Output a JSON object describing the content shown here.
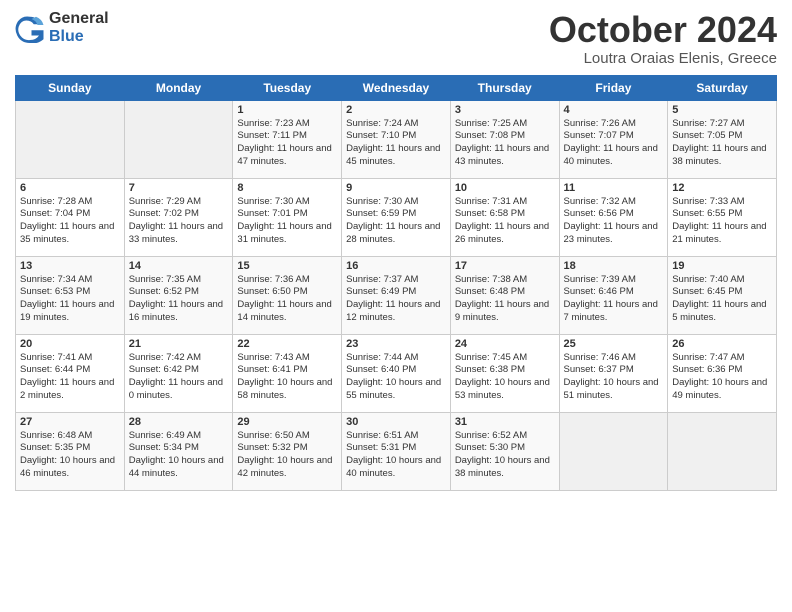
{
  "header": {
    "logo_general": "General",
    "logo_blue": "Blue",
    "title": "October 2024",
    "location": "Loutra Oraias Elenis, Greece"
  },
  "calendar": {
    "days_of_week": [
      "Sunday",
      "Monday",
      "Tuesday",
      "Wednesday",
      "Thursday",
      "Friday",
      "Saturday"
    ],
    "weeks": [
      [
        {
          "day": "",
          "info": ""
        },
        {
          "day": "",
          "info": ""
        },
        {
          "day": "1",
          "info": "Sunrise: 7:23 AM\nSunset: 7:11 PM\nDaylight: 11 hours and 47 minutes."
        },
        {
          "day": "2",
          "info": "Sunrise: 7:24 AM\nSunset: 7:10 PM\nDaylight: 11 hours and 45 minutes."
        },
        {
          "day": "3",
          "info": "Sunrise: 7:25 AM\nSunset: 7:08 PM\nDaylight: 11 hours and 43 minutes."
        },
        {
          "day": "4",
          "info": "Sunrise: 7:26 AM\nSunset: 7:07 PM\nDaylight: 11 hours and 40 minutes."
        },
        {
          "day": "5",
          "info": "Sunrise: 7:27 AM\nSunset: 7:05 PM\nDaylight: 11 hours and 38 minutes."
        }
      ],
      [
        {
          "day": "6",
          "info": "Sunrise: 7:28 AM\nSunset: 7:04 PM\nDaylight: 11 hours and 35 minutes."
        },
        {
          "day": "7",
          "info": "Sunrise: 7:29 AM\nSunset: 7:02 PM\nDaylight: 11 hours and 33 minutes."
        },
        {
          "day": "8",
          "info": "Sunrise: 7:30 AM\nSunset: 7:01 PM\nDaylight: 11 hours and 31 minutes."
        },
        {
          "day": "9",
          "info": "Sunrise: 7:30 AM\nSunset: 6:59 PM\nDaylight: 11 hours and 28 minutes."
        },
        {
          "day": "10",
          "info": "Sunrise: 7:31 AM\nSunset: 6:58 PM\nDaylight: 11 hours and 26 minutes."
        },
        {
          "day": "11",
          "info": "Sunrise: 7:32 AM\nSunset: 6:56 PM\nDaylight: 11 hours and 23 minutes."
        },
        {
          "day": "12",
          "info": "Sunrise: 7:33 AM\nSunset: 6:55 PM\nDaylight: 11 hours and 21 minutes."
        }
      ],
      [
        {
          "day": "13",
          "info": "Sunrise: 7:34 AM\nSunset: 6:53 PM\nDaylight: 11 hours and 19 minutes."
        },
        {
          "day": "14",
          "info": "Sunrise: 7:35 AM\nSunset: 6:52 PM\nDaylight: 11 hours and 16 minutes."
        },
        {
          "day": "15",
          "info": "Sunrise: 7:36 AM\nSunset: 6:50 PM\nDaylight: 11 hours and 14 minutes."
        },
        {
          "day": "16",
          "info": "Sunrise: 7:37 AM\nSunset: 6:49 PM\nDaylight: 11 hours and 12 minutes."
        },
        {
          "day": "17",
          "info": "Sunrise: 7:38 AM\nSunset: 6:48 PM\nDaylight: 11 hours and 9 minutes."
        },
        {
          "day": "18",
          "info": "Sunrise: 7:39 AM\nSunset: 6:46 PM\nDaylight: 11 hours and 7 minutes."
        },
        {
          "day": "19",
          "info": "Sunrise: 7:40 AM\nSunset: 6:45 PM\nDaylight: 11 hours and 5 minutes."
        }
      ],
      [
        {
          "day": "20",
          "info": "Sunrise: 7:41 AM\nSunset: 6:44 PM\nDaylight: 11 hours and 2 minutes."
        },
        {
          "day": "21",
          "info": "Sunrise: 7:42 AM\nSunset: 6:42 PM\nDaylight: 11 hours and 0 minutes."
        },
        {
          "day": "22",
          "info": "Sunrise: 7:43 AM\nSunset: 6:41 PM\nDaylight: 10 hours and 58 minutes."
        },
        {
          "day": "23",
          "info": "Sunrise: 7:44 AM\nSunset: 6:40 PM\nDaylight: 10 hours and 55 minutes."
        },
        {
          "day": "24",
          "info": "Sunrise: 7:45 AM\nSunset: 6:38 PM\nDaylight: 10 hours and 53 minutes."
        },
        {
          "day": "25",
          "info": "Sunrise: 7:46 AM\nSunset: 6:37 PM\nDaylight: 10 hours and 51 minutes."
        },
        {
          "day": "26",
          "info": "Sunrise: 7:47 AM\nSunset: 6:36 PM\nDaylight: 10 hours and 49 minutes."
        }
      ],
      [
        {
          "day": "27",
          "info": "Sunrise: 6:48 AM\nSunset: 5:35 PM\nDaylight: 10 hours and 46 minutes."
        },
        {
          "day": "28",
          "info": "Sunrise: 6:49 AM\nSunset: 5:34 PM\nDaylight: 10 hours and 44 minutes."
        },
        {
          "day": "29",
          "info": "Sunrise: 6:50 AM\nSunset: 5:32 PM\nDaylight: 10 hours and 42 minutes."
        },
        {
          "day": "30",
          "info": "Sunrise: 6:51 AM\nSunset: 5:31 PM\nDaylight: 10 hours and 40 minutes."
        },
        {
          "day": "31",
          "info": "Sunrise: 6:52 AM\nSunset: 5:30 PM\nDaylight: 10 hours and 38 minutes."
        },
        {
          "day": "",
          "info": ""
        },
        {
          "day": "",
          "info": ""
        }
      ]
    ]
  }
}
